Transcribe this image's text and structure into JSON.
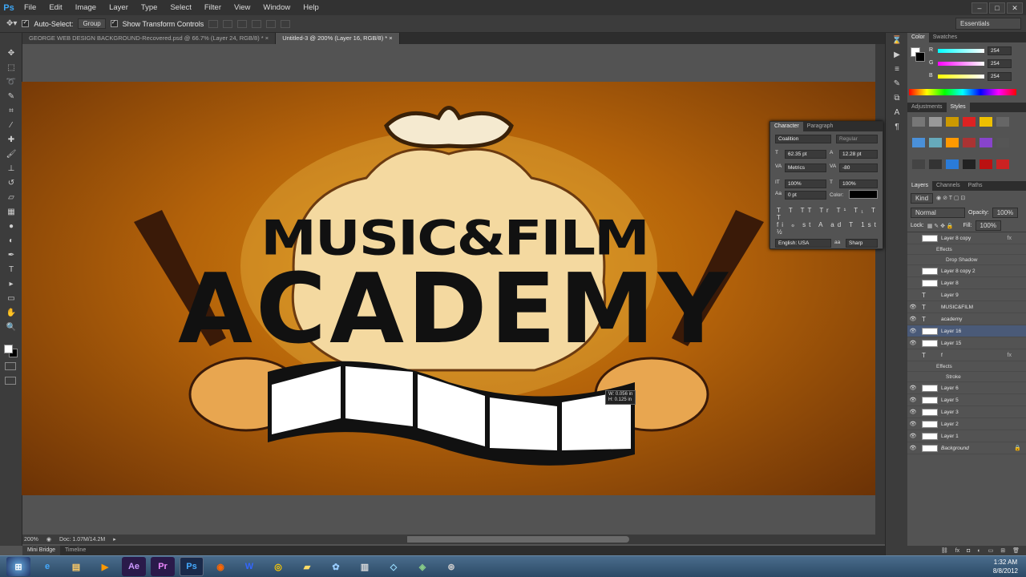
{
  "app": {
    "logo": "Ps"
  },
  "menu": [
    "File",
    "Edit",
    "Image",
    "Layer",
    "Type",
    "Select",
    "Filter",
    "View",
    "Window",
    "Help"
  ],
  "options": {
    "auto_select": "Auto-Select:",
    "group": "Group",
    "show_transform": "Show Transform Controls"
  },
  "workspace": "Essentials",
  "tabs": [
    {
      "label": "GEORGE WEB DESIGN BACKGROUND-Recovered.psd @ 66.7% (Layer 24, RGB/8) *",
      "close": "×"
    },
    {
      "label": "Untitled-3 @ 200% (Layer 16, RGB/8) *",
      "close": "×"
    }
  ],
  "canvas": {
    "title_line1": "MUSIC&FILM",
    "title_line2": "ACADEMY",
    "cursor_tooltip_w": "W: 0.056 in",
    "cursor_tooltip_h": "H: 0.125 in",
    "art_colors": {
      "bg": "#c47510",
      "text": "#111111"
    }
  },
  "status": {
    "zoom": "200%",
    "doc": "Doc: 1.07M/14.2M"
  },
  "mini_tabs": [
    "Mini Bridge",
    "Timeline"
  ],
  "color_panel": {
    "tabs": [
      "Color",
      "Swatches"
    ],
    "r": "254",
    "g": "254",
    "b": "254",
    "r_label": "R",
    "g_label": "G",
    "b_label": "B"
  },
  "styles_panel": {
    "tabs": [
      "Adjustments",
      "Styles"
    ]
  },
  "layers_panel": {
    "tabs": [
      "Layers",
      "Channels",
      "Paths"
    ],
    "kind": "Kind",
    "blend": "Normal",
    "opacity_label": "Opacity:",
    "opacity": "100%",
    "lock_label": "Lock:",
    "fill_label": "Fill:",
    "fill": "100%",
    "layers": [
      {
        "name": "Layer 8 copy",
        "vis": false,
        "fx": true
      },
      {
        "name": "Effects",
        "sub": true
      },
      {
        "name": "Drop Shadow",
        "sub": true
      },
      {
        "name": "Layer 8 copy 2",
        "vis": false
      },
      {
        "name": "Layer 8",
        "vis": false
      },
      {
        "name": "Layer 9",
        "vis": false,
        "type": "T"
      },
      {
        "name": "MUSIC&FILM",
        "vis": true,
        "type": "T"
      },
      {
        "name": "academy",
        "vis": true,
        "type": "T"
      },
      {
        "name": "Layer 16",
        "vis": true,
        "selected": true
      },
      {
        "name": "Layer 15",
        "vis": true
      },
      {
        "name": "f",
        "vis": false,
        "type": "T",
        "fx": true
      },
      {
        "name": "Effects",
        "sub": true
      },
      {
        "name": "Stroke",
        "sub": true
      },
      {
        "name": "Layer 6",
        "vis": true
      },
      {
        "name": "Layer 5",
        "vis": true
      },
      {
        "name": "Layer 3",
        "vis": true
      },
      {
        "name": "Layer 2",
        "vis": true
      },
      {
        "name": "Layer 1",
        "vis": true
      },
      {
        "name": "Background",
        "vis": true,
        "locked": true
      }
    ]
  },
  "character_panel": {
    "tabs": [
      "Character",
      "Paragraph"
    ],
    "font": "Coalition",
    "style": "Regular",
    "size": "62.35 pt",
    "leading": "12.28 pt",
    "kerning": "Metrics",
    "tracking": "-80",
    "vscale": "100%",
    "hscale": "100%",
    "baseline": "0 pt",
    "color_label": "Color:",
    "language": "English: USA",
    "aa": "Sharp",
    "aa_label": "aa"
  },
  "taskbar": {
    "apps": [
      "IE",
      "Explorer",
      "Media",
      "Ae",
      "Pr",
      "Ps",
      "Firefox",
      "Word",
      "Chrome",
      "Folder",
      "Paint",
      "Kindle",
      "Tool",
      "Steam",
      "Xbox"
    ],
    "time": "1:32 AM",
    "date": "8/8/2012"
  }
}
